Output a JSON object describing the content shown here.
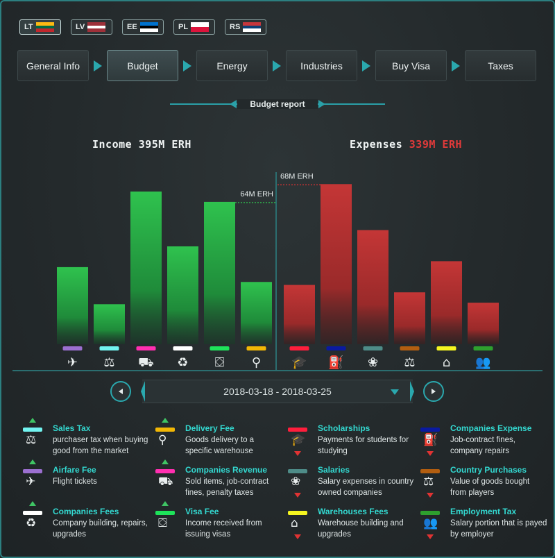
{
  "countries": [
    {
      "code": "LT",
      "colors": [
        "#fdb913",
        "#006a44",
        "#c1272d"
      ],
      "active": true
    },
    {
      "code": "LV",
      "colors": [
        "#9e3039",
        "#ffffff",
        "#9e3039"
      ],
      "active": false
    },
    {
      "code": "EE",
      "colors": [
        "#0072ce",
        "#000000",
        "#ffffff"
      ],
      "active": false
    },
    {
      "code": "PL",
      "colors": [
        "#ffffff",
        "#dc143c"
      ],
      "active": false
    },
    {
      "code": "RS",
      "colors": [
        "#c6363c",
        "#0c4076",
        "#ffffff"
      ],
      "active": false
    }
  ],
  "nav": {
    "items": [
      "General Info",
      "Budget",
      "Energy",
      "Industries",
      "Buy Visa",
      "Taxes"
    ],
    "active": "Budget"
  },
  "report": {
    "title": "Budget report"
  },
  "summary": {
    "income_label": "Income",
    "income_value": "395M ERH",
    "expenses_label": "Expenses",
    "expenses_value": "339M ERH"
  },
  "chart_data": {
    "type": "bar",
    "title": "",
    "income": {
      "categories": [
        "Airfare Fee",
        "Sales Tax",
        "Companies Revenue",
        "Companies Fees",
        "Visa Fee",
        "Delivery Fee"
      ],
      "values": [
        52,
        27,
        103,
        66,
        96,
        42
      ],
      "colors": [
        "#9b6fd0",
        "#72f4f0",
        "#ff2fb0",
        "#ffffff",
        "#1ee35a",
        "#f2b705"
      ],
      "icons": [
        "airplane-icon",
        "scales-icon",
        "sales-revenue-icon",
        "companies-fees-icon",
        "visa-suitcase-icon",
        "delivery-pin-icon"
      ],
      "annotation": {
        "index": 4,
        "label": "64M ERH"
      }
    },
    "expenses": {
      "categories": [
        "Scholarships",
        "Companies Expense",
        "Salaries",
        "Country Purchases",
        "Warehouses Fees",
        "Employment Tax"
      ],
      "values": [
        40,
        108,
        77,
        35,
        56,
        28
      ],
      "colors": [
        "#ff1e3c",
        "#0a1aa0",
        "#4e8c88",
        "#b35e10",
        "#f5f520",
        "#2ea02e"
      ],
      "icons": [
        "graduation-cap-icon",
        "oil-pump-icon",
        "salary-money-icon",
        "weight-scale-icon",
        "warehouse-icon",
        "employees-icon"
      ],
      "annotation": {
        "index": 1,
        "label": "68M ERH"
      }
    },
    "grid": false
  },
  "date_range": {
    "label": "2018-03-18 - 2018-03-25"
  },
  "legend": [
    {
      "name": "Sales Tax",
      "desc": "purchaser tax when buying good from the market",
      "color": "#72f4f0",
      "trend": "up",
      "icon": "scales-icon",
      "glyph": "⚖"
    },
    {
      "name": "Airfare Fee",
      "desc": "Flight tickets",
      "color": "#9b6fd0",
      "trend": "up",
      "icon": "airplane-icon",
      "glyph": "✈"
    },
    {
      "name": "Companies Fees",
      "desc": "Company building, repairs, upgrades",
      "color": "#ffffff",
      "trend": "up",
      "icon": "companies-fees-icon",
      "glyph": "♻"
    },
    {
      "name": "Delivery Fee",
      "desc": "Goods delivery to a specific warehouse",
      "color": "#f2b705",
      "trend": "up",
      "icon": "delivery-pin-icon",
      "glyph": "⚲"
    },
    {
      "name": "Companies Revenue",
      "desc": "Sold items, job-contract fines, penalty taxes",
      "color": "#ff2fb0",
      "trend": "up",
      "icon": "sales-revenue-icon",
      "glyph": "⛟"
    },
    {
      "name": "Visa Fee",
      "desc": "Income received from issuing visas",
      "color": "#1ee35a",
      "trend": "up",
      "icon": "visa-suitcase-icon",
      "glyph": "⛋"
    },
    {
      "name": "Scholarships",
      "desc": "Payments for students for studying",
      "color": "#ff1e3c",
      "trend": "down",
      "icon": "graduation-cap-icon",
      "glyph": "🎓"
    },
    {
      "name": "Salaries",
      "desc": "Salary expenses in country owned companies",
      "color": "#4e8c88",
      "trend": "down",
      "icon": "salary-money-icon",
      "glyph": "❀"
    },
    {
      "name": "Warehouses Fees",
      "desc": "Warehouse building and upgrades",
      "color": "#f5f520",
      "trend": "down",
      "icon": "warehouse-icon",
      "glyph": "⌂"
    },
    {
      "name": "Companies Expense",
      "desc": "Job-contract fines, company repairs",
      "color": "#0a1aa0",
      "trend": "down",
      "icon": "oil-pump-icon",
      "glyph": "⛽"
    },
    {
      "name": "Country Purchases",
      "desc": "Value of goods bought from players",
      "color": "#b35e10",
      "trend": "down",
      "icon": "weight-scale-icon",
      "glyph": "⚖"
    },
    {
      "name": "Employment Tax",
      "desc": "Salary portion that is payed by employer",
      "color": "#2ea02e",
      "trend": "down",
      "icon": "employees-icon",
      "glyph": "👥"
    }
  ]
}
